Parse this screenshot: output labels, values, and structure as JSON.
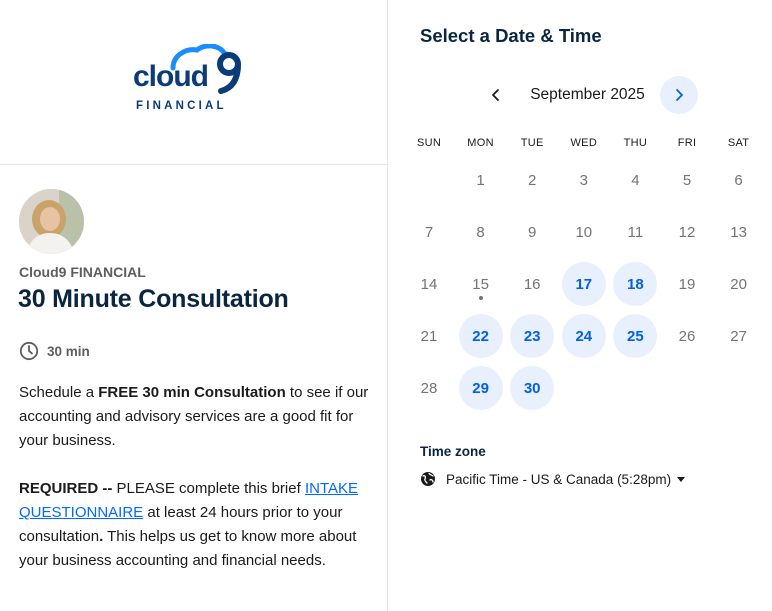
{
  "brand": {
    "logo_word": "cloud",
    "logo_digit": "9",
    "logo_sub": "FINANCIAL",
    "colors": {
      "logo_navy": "#0c3c78",
      "logo_blue": "#1a8cff"
    }
  },
  "organizer": {
    "name": "Cloud9 FINANCIAL",
    "avatar_icon": "person-photo"
  },
  "event": {
    "title": "30 Minute Consultation",
    "duration": "30 min",
    "description": {
      "p1_pre": "Schedule a ",
      "p1_bold": "FREE 30 min Consultation",
      "p1_post": " to see if our accounting and advisory services are a good fit for your business.",
      "p2_bold1": "REQUIRED --",
      "p2_pre": " PLEASE complete this brief ",
      "p2_link": "INTAKE QUESTIONNAIRE",
      "p2_mid": " at least 24 hours prior to your consultation",
      "p2_bold2": ".",
      "p2_post": " This helps us get to know more about your business accounting and financial needs."
    }
  },
  "calendar": {
    "heading": "Select a Date & Time",
    "month_label": "September 2025",
    "weekdays": [
      "SUN",
      "MON",
      "TUE",
      "WED",
      "THU",
      "FRI",
      "SAT"
    ],
    "first_weekday_index": 1,
    "days_in_month": 30,
    "available_days": [
      17,
      18,
      22,
      23,
      24,
      25,
      29,
      30
    ],
    "today": 15,
    "accent": "#0060e6",
    "available_bg": "#e8f0fe"
  },
  "timezone": {
    "label": "Time zone",
    "value": "Pacific Time - US & Canada (5:28pm)"
  }
}
